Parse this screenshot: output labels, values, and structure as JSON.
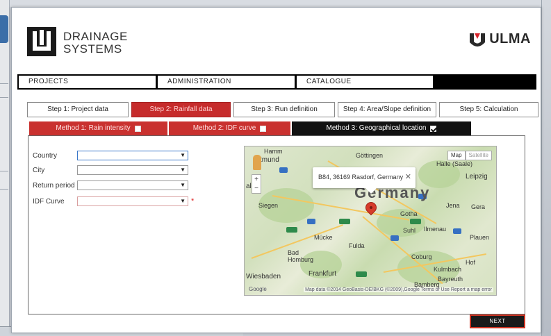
{
  "brand": {
    "line1": "DRAINAGE",
    "line2": "SYSTEMS",
    "partner": "ULMA"
  },
  "nav": {
    "projects": "PROJECTS",
    "administration": "ADMINISTRATION",
    "catalogue": "CATALOGUE"
  },
  "steps": [
    {
      "label": "Step 1: Project data",
      "active": false
    },
    {
      "label": "Step 2: Rainfall data",
      "active": true
    },
    {
      "label": "Step 3: Run definition",
      "active": false
    },
    {
      "label": "Step 4: Area/Slope definition",
      "active": false
    },
    {
      "label": "Step 5: Calculation",
      "active": false
    }
  ],
  "methods": [
    {
      "label": "Method 1: Rain intensity",
      "checked": false
    },
    {
      "label": "Method 2: IDF curve",
      "checked": false
    },
    {
      "label": "Method 3: Geographical location",
      "checked": true
    }
  ],
  "form": {
    "country_label": "Country",
    "city_label": "City",
    "return_label": "Return period",
    "idf_label": "IDF Curve",
    "required_mark": "*"
  },
  "map": {
    "country": "Germany",
    "infowindow": "B84, 36169 Rasdorf, Germany",
    "map_btn": "Map",
    "satellite_btn": "Satellite",
    "attribution": "Map data ©2014 GeoBasis-DE/BKG (©2009),Google   Terms of Use   Report a map error",
    "google": "Google",
    "cities": [
      {
        "name": "Hamm",
        "cls": ""
      },
      {
        "name": "tmund",
        "cls": "big"
      },
      {
        "name": "Göttingen",
        "cls": ""
      },
      {
        "name": "Halle (Saale)",
        "cls": ""
      },
      {
        "name": "Leipzig",
        "cls": "big"
      },
      {
        "name": "Siegen",
        "cls": ""
      },
      {
        "name": "Gotha",
        "cls": ""
      },
      {
        "name": "Jena",
        "cls": ""
      },
      {
        "name": "Gera",
        "cls": ""
      },
      {
        "name": "Suhl",
        "cls": ""
      },
      {
        "name": "Ilmenau",
        "cls": ""
      },
      {
        "name": "Plauen",
        "cls": ""
      },
      {
        "name": "Fulda",
        "cls": ""
      },
      {
        "name": "Bad Homburg",
        "cls": ""
      },
      {
        "name": "Coburg",
        "cls": ""
      },
      {
        "name": "Kulmbach",
        "cls": ""
      },
      {
        "name": "Hof",
        "cls": ""
      },
      {
        "name": "Frankfurt",
        "cls": "big"
      },
      {
        "name": "Wiesbaden",
        "cls": "big"
      },
      {
        "name": "Bamberg",
        "cls": ""
      },
      {
        "name": "Bayreuth",
        "cls": ""
      },
      {
        "name": "Mücke",
        "cls": ""
      },
      {
        "name": "al",
        "cls": "big"
      }
    ]
  },
  "next_label": "NEXT",
  "colors": {
    "accent_red": "#c62c2c",
    "nav_black": "#000000"
  }
}
